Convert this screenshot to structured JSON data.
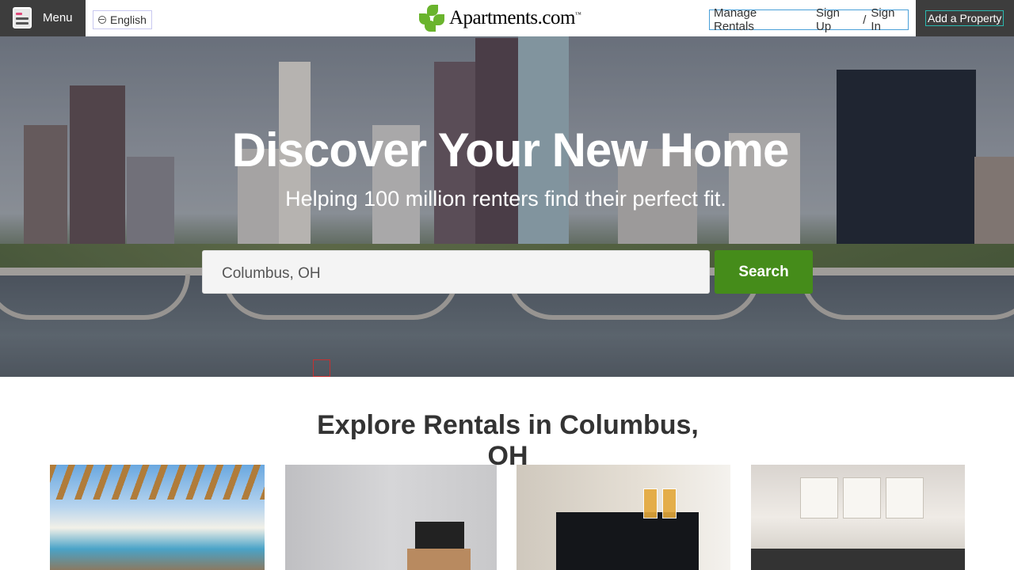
{
  "header": {
    "menu_label": "Menu",
    "language": "English",
    "logo_text": "Apartments.com",
    "logo_tm": "™",
    "manage_rentals": "Manage Rentals",
    "sign_up": "Sign Up",
    "slash": "/",
    "sign_in": "Sign In",
    "add_property": "Add a Property"
  },
  "hero": {
    "title": "Discover Your New Home",
    "subtitle": "Helping 100 million renters find their perfect fit.",
    "search": {
      "value": "Columbus, OH",
      "placeholder": ""
    },
    "search_button": "Search"
  },
  "explore": {
    "title": "Explore Rentals in Columbus, OH",
    "cards": [
      {
        "image": "pool-pergola-photo"
      },
      {
        "image": "living-room-photo"
      },
      {
        "image": "bar-lounge-photo"
      },
      {
        "image": "kitchen-photo"
      }
    ]
  },
  "colors": {
    "header_dark": "#3d3d3d",
    "search_green": "#458c1a",
    "logo_green": "#6ab42d"
  }
}
